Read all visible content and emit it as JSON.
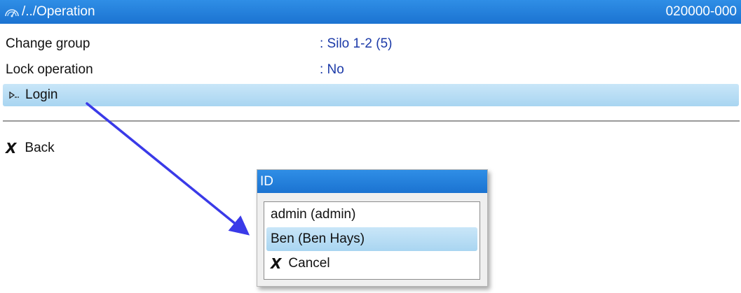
{
  "header": {
    "path": "/../Operation",
    "code": "020000-000",
    "icon": "gauge-icon"
  },
  "settings": [
    {
      "label": "Change group",
      "value": ": Silo 1-2 (5)"
    },
    {
      "label": "Lock operation",
      "value": ": No"
    }
  ],
  "login": {
    "label": "Login",
    "icon": "login-arrow-icon"
  },
  "back": {
    "label": "Back",
    "icon": "x-icon"
  },
  "popup": {
    "title": "ID",
    "items": [
      {
        "label": "admin (admin)"
      },
      {
        "label": "Ben (Ben Hays)",
        "selected": true
      },
      {
        "label": "Cancel",
        "icon": "x-icon"
      }
    ]
  },
  "colors": {
    "title_bar": "#1f7ad6",
    "selection": "#b7ddf5",
    "value_text": "#1c3aa8",
    "annotation_arrow": "#3a3ae8"
  }
}
